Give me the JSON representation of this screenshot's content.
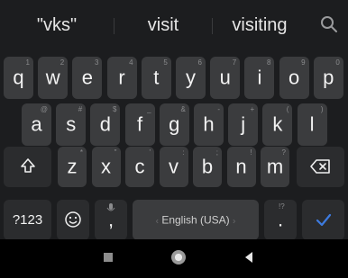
{
  "suggestions": [
    "\"vks\"",
    "visit",
    "visiting"
  ],
  "rows": [
    [
      {
        "c": "q",
        "h": "1"
      },
      {
        "c": "w",
        "h": "2"
      },
      {
        "c": "e",
        "h": "3"
      },
      {
        "c": "r",
        "h": "4"
      },
      {
        "c": "t",
        "h": "5"
      },
      {
        "c": "y",
        "h": "6"
      },
      {
        "c": "u",
        "h": "7"
      },
      {
        "c": "i",
        "h": "8"
      },
      {
        "c": "o",
        "h": "9"
      },
      {
        "c": "p",
        "h": "0"
      }
    ],
    [
      {
        "c": "a",
        "h": "@"
      },
      {
        "c": "s",
        "h": "#"
      },
      {
        "c": "d",
        "h": "$"
      },
      {
        "c": "f",
        "h": "_"
      },
      {
        "c": "g",
        "h": "&"
      },
      {
        "c": "h",
        "h": "-"
      },
      {
        "c": "j",
        "h": "+"
      },
      {
        "c": "k",
        "h": "("
      },
      {
        "c": "l",
        "h": ")"
      }
    ],
    [
      {
        "c": "z",
        "h": "*"
      },
      {
        "c": "x",
        "h": "\""
      },
      {
        "c": "c",
        "h": "'"
      },
      {
        "c": "v",
        "h": ":"
      },
      {
        "c": "b",
        "h": ";"
      },
      {
        "c": "n",
        "h": "!"
      },
      {
        "c": "m",
        "h": "?"
      }
    ]
  ],
  "bottom": {
    "sym_label": "?123",
    "comma": ",",
    "space_label": "English (USA)",
    "period": ".",
    "period_hint": "!?"
  },
  "colors": {
    "accent": "#3d7be0",
    "key_bg": "#3b3c3e",
    "fn_bg": "#2b2c2e",
    "board_bg": "#1c1d1f"
  }
}
